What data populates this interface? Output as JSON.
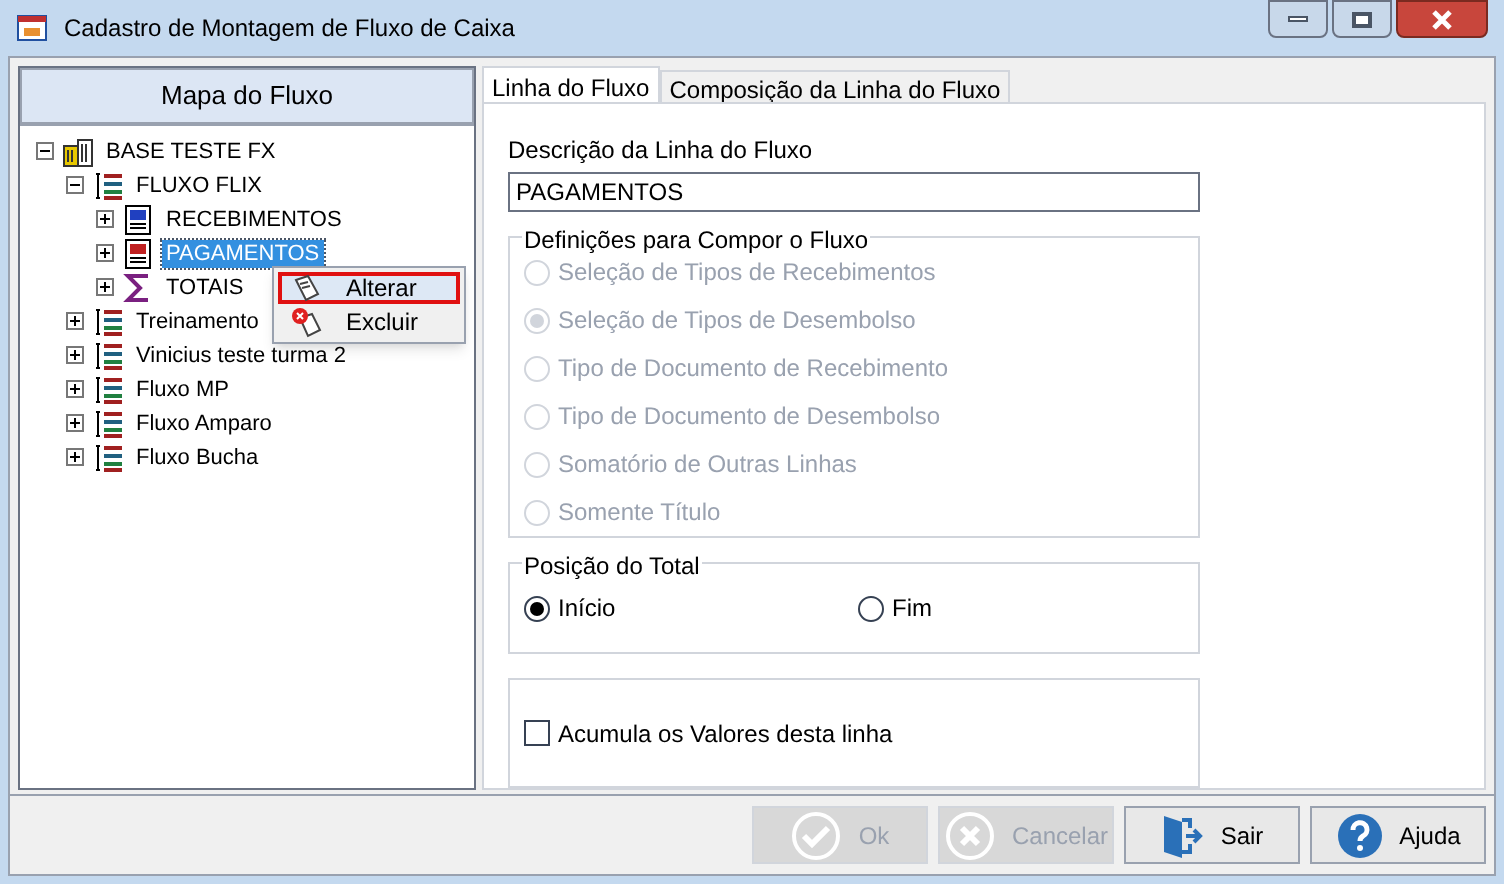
{
  "window": {
    "title": "Cadastro de Montagem de Fluxo de Caixa"
  },
  "sidebar": {
    "title": "Mapa do Fluxo",
    "tree": [
      {
        "label": "BASE TESTE FX",
        "kind": "base",
        "expanded": true,
        "selected": false,
        "children": [
          {
            "label": "FLUXO FLIX",
            "kind": "flow",
            "expanded": true,
            "selected": false,
            "children": [
              {
                "label": "RECEBIMENTOS",
                "kind": "receipt",
                "expanded": false,
                "selected": false
              },
              {
                "label": "PAGAMENTOS",
                "kind": "payment",
                "expanded": false,
                "selected": true
              },
              {
                "label": "TOTAIS",
                "kind": "total",
                "expanded": false,
                "selected": false
              }
            ]
          },
          {
            "label": "Treinamento",
            "kind": "flow",
            "expanded": false,
            "selected": false
          },
          {
            "label": "Vinicius teste turma 2",
            "kind": "flow",
            "expanded": false,
            "selected": false
          },
          {
            "label": "Fluxo MP",
            "kind": "flow",
            "expanded": false,
            "selected": false
          },
          {
            "label": "Fluxo Amparo",
            "kind": "flow",
            "expanded": false,
            "selected": false
          },
          {
            "label": "Fluxo Bucha",
            "kind": "flow",
            "expanded": false,
            "selected": false
          }
        ]
      }
    ]
  },
  "context_menu": [
    {
      "label": "Alterar",
      "kind": "edit",
      "selected": true
    },
    {
      "label": "Excluir",
      "kind": "delete",
      "selected": false
    }
  ],
  "tabs": [
    {
      "label": "Linha do Fluxo",
      "selected": true
    },
    {
      "label": "Composição da Linha do Fluxo",
      "selected": false
    }
  ],
  "description": {
    "label": "Descrição da Linha do Fluxo",
    "value": "PAGAMENTOS"
  },
  "definitions": {
    "title": "Definições para Compor o Fluxo",
    "options": [
      {
        "label": "Seleção de Tipos de Recebimentos",
        "selected": false,
        "disabled": true
      },
      {
        "label": "Seleção de Tipos de Desembolso",
        "selected": true,
        "disabled": true
      },
      {
        "label": "Tipo de Documento de Recebimento",
        "selected": false,
        "disabled": true
      },
      {
        "label": "Tipo de Documento de Desembolso",
        "selected": false,
        "disabled": true
      },
      {
        "label": "Somatório de Outras Linhas",
        "selected": false,
        "disabled": true
      },
      {
        "label": "Somente Título",
        "selected": false,
        "disabled": true
      }
    ]
  },
  "total_position": {
    "title": "Posição do Total",
    "options": [
      {
        "label": "Início",
        "selected": true
      },
      {
        "label": "Fim",
        "selected": false
      }
    ]
  },
  "accumulate": {
    "label": "Acumula os Valores desta linha",
    "checked": false
  },
  "buttons": [
    {
      "label": "Ok",
      "kind": "ok",
      "disabled": true
    },
    {
      "label": "Cancelar",
      "kind": "cancel",
      "disabled": true
    },
    {
      "label": "Sair",
      "kind": "exit",
      "disabled": false
    },
    {
      "label": "Ajuda",
      "kind": "help",
      "disabled": false
    }
  ]
}
